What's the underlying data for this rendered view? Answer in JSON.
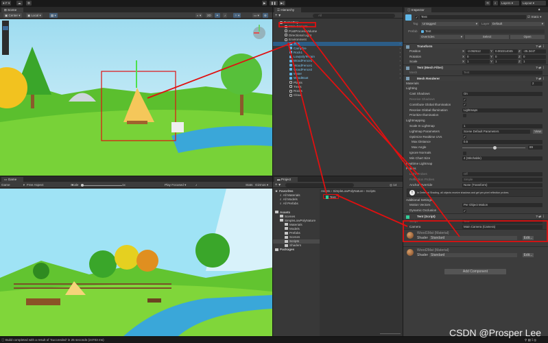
{
  "toolbar": {
    "account": "F",
    "layers": "Layers",
    "layout": "Layout"
  },
  "scene": {
    "tab": "Scene",
    "pivot": "Center",
    "space": "Local"
  },
  "game": {
    "tab": "Game",
    "display": "Game",
    "aspect": "Free Aspect",
    "scale_label": "Scale",
    "scale_value": "1x",
    "play_mode": "Play Focused",
    "stats": "Stats",
    "gizmos": "Gizmos"
  },
  "hierarchy": {
    "tab": "Hierarchy",
    "search_placeholder": "All",
    "items": [
      {
        "label": "DemoDay",
        "indent": 0,
        "icon": "scene",
        "bold": true
      },
      {
        "label": "Main Camera",
        "indent": 1,
        "icon": "gameobject"
      },
      {
        "label": "PostProcessVolume",
        "indent": 1,
        "icon": "gameobject"
      },
      {
        "label": "Directional Light",
        "indent": 1,
        "icon": "gameobject"
      },
      {
        "label": "Environment",
        "indent": 1,
        "icon": "gameobject"
      },
      {
        "label": "Tent",
        "indent": 2,
        "icon": "prefab",
        "selected": true
      },
      {
        "label": "Campfire",
        "indent": 2,
        "icon": "prefab"
      },
      {
        "label": "Rock1",
        "indent": 2,
        "icon": "prefab"
      },
      {
        "label": "LowpolyTerrain",
        "indent": 2,
        "icon": "prefab"
      },
      {
        "label": "WoodFence1",
        "indent": 2,
        "icon": "prefab"
      },
      {
        "label": "WoodFence1",
        "indent": 2,
        "icon": "prefab"
      },
      {
        "label": "WoodFence2",
        "indent": 2,
        "icon": "prefab"
      },
      {
        "label": "Water",
        "indent": 2,
        "icon": "prefab"
      },
      {
        "label": "WoodBoat",
        "indent": 2,
        "icon": "prefab"
      },
      {
        "label": "Plants",
        "indent": 2,
        "icon": "gameobject"
      },
      {
        "label": "Trees",
        "indent": 2,
        "icon": "gameobject"
      },
      {
        "label": "Rocks",
        "indent": 2,
        "icon": "gameobject"
      },
      {
        "label": "Cloud",
        "indent": 2,
        "icon": "gameobject"
      }
    ]
  },
  "project": {
    "tab": "Project",
    "count": "14",
    "breadcrumb": [
      "Assets",
      "SimpleLowPolyNature",
      "Scripts"
    ],
    "file": "Tent",
    "tree": [
      {
        "label": "Favorites",
        "indent": 0,
        "bold": true
      },
      {
        "label": "All Materials",
        "indent": 1,
        "search": true
      },
      {
        "label": "All Models",
        "indent": 1,
        "search": true
      },
      {
        "label": "All Prefabs",
        "indent": 1,
        "search": true
      },
      {
        "label": "",
        "indent": 0,
        "spacer": true
      },
      {
        "label": "Assets",
        "indent": 0,
        "bold": true
      },
      {
        "label": "Scenes",
        "indent": 1
      },
      {
        "label": "SimpleLowPolyNature",
        "indent": 1
      },
      {
        "label": "Materials",
        "indent": 2
      },
      {
        "label": "Models",
        "indent": 2
      },
      {
        "label": "Prefabs",
        "indent": 2
      },
      {
        "label": "Scenes",
        "indent": 2
      },
      {
        "label": "Scripts",
        "indent": 2,
        "selected": true
      },
      {
        "label": "Shaders",
        "indent": 2
      },
      {
        "label": "Packages",
        "indent": 0,
        "bold": true
      }
    ]
  },
  "inspector": {
    "tab": "Inspector",
    "object_name": "Tent",
    "static": "Static",
    "tag_label": "Tag",
    "tag": "Untagged",
    "layer_label": "Layer",
    "layer": "Default",
    "prefab_label": "Prefab",
    "prefab": "Tent",
    "overrides": "Overrides",
    "select": "Select",
    "open": "Open",
    "rows": [
      {
        "type": "hdr",
        "label": "Transform"
      },
      {
        "type": "vec",
        "label": "Position",
        "x": "-2.052512",
        "y": "0.002214045",
        "z": "-25.3447"
      },
      {
        "type": "vec",
        "label": "Rotation",
        "x": "0",
        "y": "0",
        "z": "0"
      },
      {
        "type": "vec",
        "label": "Scale",
        "x": "1",
        "y": "1",
        "z": "1"
      },
      {
        "type": "hdr",
        "label": "Tent (Mesh Filter)"
      },
      {
        "type": "field",
        "label": "Mesh",
        "value": "Tent",
        "dim": true
      },
      {
        "type": "hdr",
        "label": "Mesh Renderer"
      },
      {
        "type": "sec",
        "label": "Materials",
        "value": "2"
      },
      {
        "type": "sec",
        "label": "Lighting"
      },
      {
        "type": "field",
        "label": "Cast Shadows",
        "value": "On"
      },
      {
        "type": "check",
        "label": "Receive Shadows",
        "dim": true,
        "checked": true
      },
      {
        "type": "check",
        "label": "Contribute Global Illumination",
        "checked": true
      },
      {
        "type": "field",
        "label": "Receive Global Illumination",
        "value": "Lightmaps"
      },
      {
        "type": "check",
        "label": "Prioritize Illumination",
        "checked": false
      },
      {
        "type": "sec",
        "label": "Lightmapping"
      },
      {
        "type": "field",
        "label": "Scale In Lightmap",
        "value": "1"
      },
      {
        "type": "field",
        "label": "Lightmap Parameters",
        "value": "Scene Default Parameters",
        "button": "View"
      },
      {
        "type": "check",
        "label": "Optimize Realtime UVs",
        "checked": true
      },
      {
        "type": "field",
        "label": "Max Distance",
        "value": "0.5",
        "indent": true
      },
      {
        "type": "slider",
        "label": "Max Angle",
        "value": "89",
        "level": 0.49,
        "indent": true
      },
      {
        "type": "check",
        "label": "Ignore Normals",
        "checked": false
      },
      {
        "type": "field",
        "label": "Min Chart Size",
        "value": "4 (Stitchable)"
      },
      {
        "type": "sec",
        "label": "Realtime Lightmap"
      },
      {
        "type": "sec",
        "label": "Probes"
      },
      {
        "type": "field",
        "label": "Light Probes",
        "value": "Off",
        "dim": true
      },
      {
        "type": "field",
        "label": "Reflection Probes",
        "value": "Simple",
        "dim": true
      },
      {
        "type": "field",
        "label": "Anchor Override",
        "value": "None (Transform)"
      },
      {
        "type": "info",
        "label": "In Deferred Shading, all objects receive shadows and get per-pixel reflection probes."
      },
      {
        "type": "sec",
        "label": "Additional Settings"
      },
      {
        "type": "field",
        "label": "Motion Vectors",
        "value": "Per Object Motion"
      },
      {
        "type": "check",
        "label": "Dynamic Occlusion",
        "checked": true
      },
      {
        "type": "hdr",
        "label": "Tent (Script)",
        "highlight": true
      },
      {
        "type": "field",
        "label": "Script",
        "value": "Tent",
        "dim": true,
        "highlight": true
      },
      {
        "type": "field",
        "label": "Camera",
        "value": "Main Camera (Camera)",
        "highlight": true
      },
      {
        "type": "mat",
        "label": "Wood1Mat (Material)",
        "shader_label": "Shader",
        "shader": "Standard",
        "edit": "Edit..."
      },
      {
        "type": "mat",
        "label": "Wood2Mat (Material)",
        "shader_label": "Shader",
        "shader": "Standard",
        "edit": "Edit..."
      }
    ],
    "add_component": "Add Component"
  },
  "status": {
    "message": "Build completed with a result of 'Succeeded' in 25 seconds (24703 ms)"
  },
  "watermark": "CSDN @Prosper Lee",
  "colors": {
    "annotation": "#e01010",
    "selection": "#2c5d87",
    "prefab": "#5fb7e8",
    "sky": "#9fe3f5",
    "grass": "#7fd43a"
  }
}
